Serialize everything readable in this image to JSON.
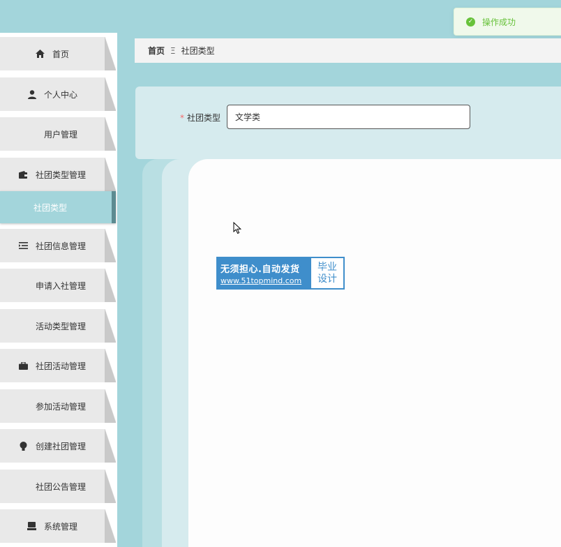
{
  "toast": {
    "message": "操作成功",
    "icon": "check-circle-icon",
    "color": "#67c23a"
  },
  "breadcrumb": {
    "home": "首页",
    "separator": "Ξ",
    "current": "社团类型"
  },
  "sidebar": {
    "items": [
      {
        "label": "首页",
        "icon": "home-icon"
      },
      {
        "label": "个人中心",
        "icon": "user-icon"
      },
      {
        "label": "用户管理",
        "icon": "grid-icon"
      },
      {
        "label": "社团类型管理",
        "icon": "wallet-icon"
      },
      {
        "label": "社团类型",
        "icon": ""
      },
      {
        "label": "社团信息管理",
        "icon": "list-icon"
      },
      {
        "label": "申请入社管理",
        "icon": "grid-icon"
      },
      {
        "label": "活动类型管理",
        "icon": "grid-icon"
      },
      {
        "label": "社团活动管理",
        "icon": "briefcase-icon"
      },
      {
        "label": "参加活动管理",
        "icon": "grid-icon"
      },
      {
        "label": "创建社团管理",
        "icon": "bulb-icon"
      },
      {
        "label": "社团公告管理",
        "icon": "grid-icon"
      },
      {
        "label": "系统管理",
        "icon": "monitor-icon"
      }
    ]
  },
  "form": {
    "field_label": "社团类型",
    "required_mark": "*",
    "field_value": "文学类"
  },
  "ad": {
    "line1": "无须担心.自动发货",
    "line2": "www.51topmind.com",
    "right_line1": "毕业",
    "right_line2": "设计"
  },
  "colors": {
    "accent": "#a3d5db",
    "active_border": "#5c8b91",
    "required": "#f56c6c",
    "ad_blue": "#3f8ecb"
  }
}
